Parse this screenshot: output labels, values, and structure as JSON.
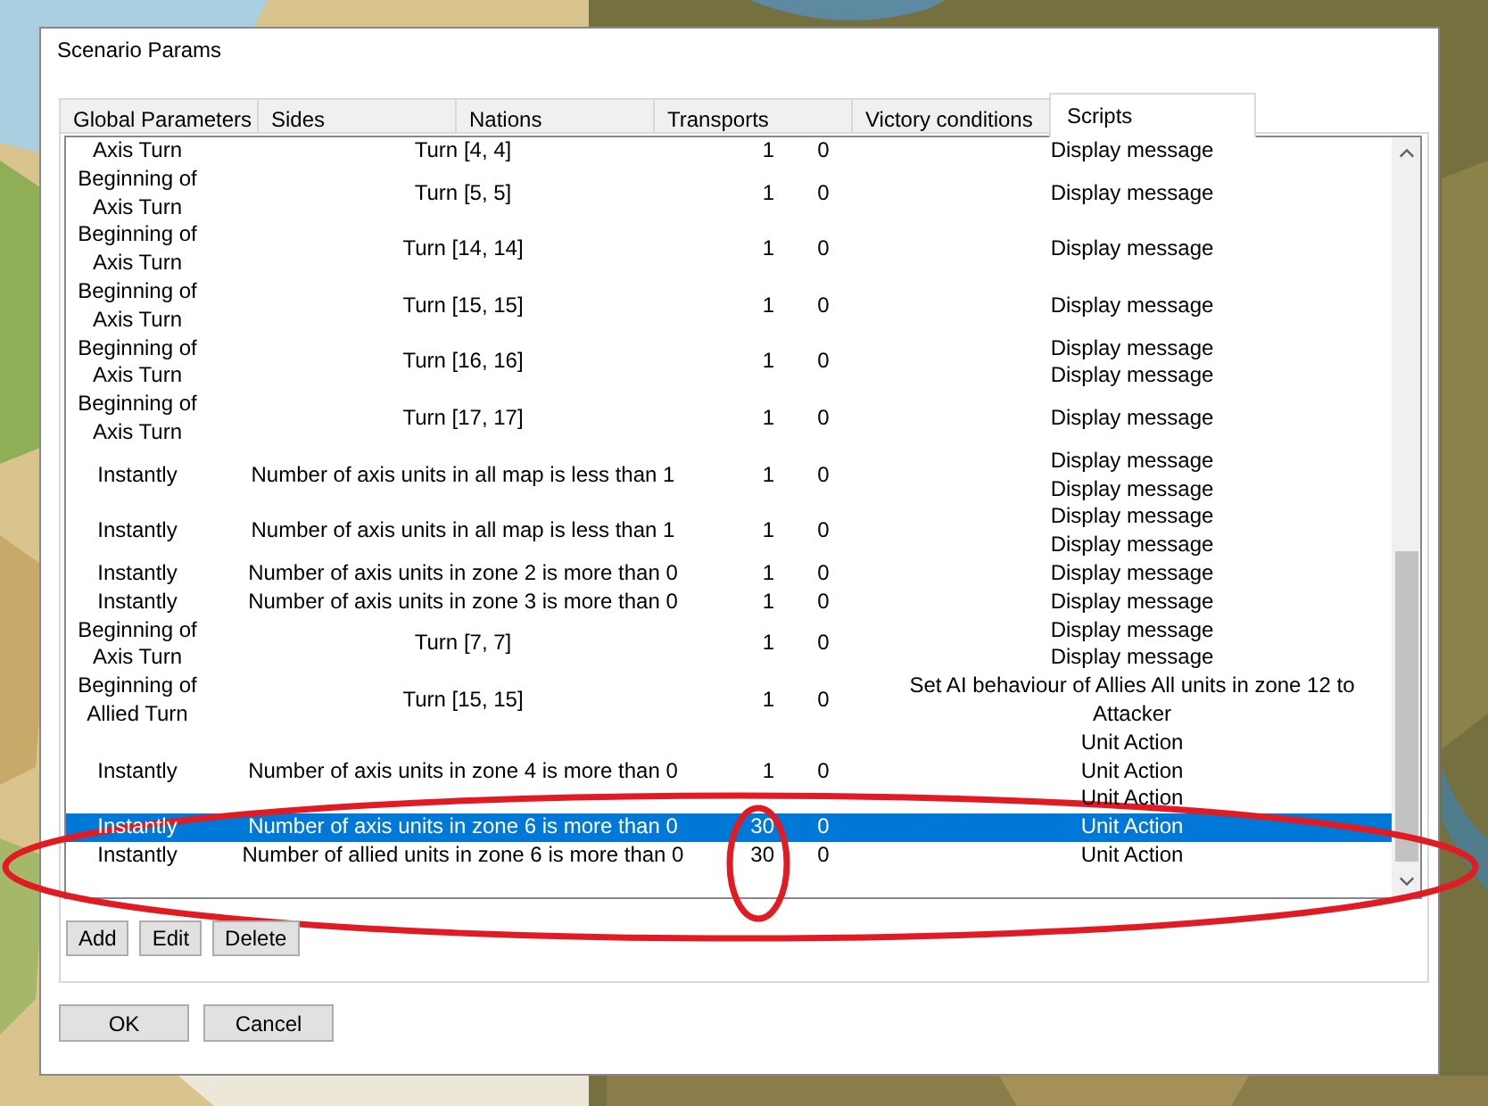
{
  "window": {
    "title": "Scenario Params"
  },
  "tabs": [
    {
      "label": "Global Parameters",
      "selected": false
    },
    {
      "label": "Sides",
      "selected": false
    },
    {
      "label": "Nations",
      "selected": false
    },
    {
      "label": "Transports",
      "selected": false
    },
    {
      "label": "Victory conditions",
      "selected": false
    },
    {
      "label": "Scripts",
      "selected": true
    }
  ],
  "table": {
    "rows": [
      {
        "column_1": "Axis Turn",
        "column_2": "Turn [4, 4]",
        "column_3": "1",
        "column_4": "0",
        "column_5": [
          "Display message"
        ],
        "selected": false
      },
      {
        "column_1": "Beginning of Axis Turn",
        "column_2": "Turn [5, 5]",
        "column_3": "1",
        "column_4": "0",
        "column_5": [
          "Display message"
        ],
        "selected": false
      },
      {
        "column_1": "Beginning of Axis Turn",
        "column_2": "Turn [14, 14]",
        "column_3": "1",
        "column_4": "0",
        "column_5": [
          "Display message"
        ],
        "selected": false
      },
      {
        "column_1": "Beginning of Axis Turn",
        "column_2": "Turn [15, 15]",
        "column_3": "1",
        "column_4": "0",
        "column_5": [
          "Display message"
        ],
        "selected": false
      },
      {
        "column_1": "Beginning of Axis Turn",
        "column_2": "Turn [16, 16]",
        "column_3": "1",
        "column_4": "0",
        "column_5": [
          "Display message",
          "Display message"
        ],
        "selected": false
      },
      {
        "column_1": "Beginning of Axis Turn",
        "column_2": "Turn [17, 17]",
        "column_3": "1",
        "column_4": "0",
        "column_5": [
          "Display message"
        ],
        "selected": false
      },
      {
        "column_1": "Instantly",
        "column_2": "Number of axis units in all map is less than 1",
        "column_3": "1",
        "column_4": "0",
        "column_5": [
          "Display message",
          "Display message"
        ],
        "selected": false
      },
      {
        "column_1": "Instantly",
        "column_2": "Number of axis units in all map is less than 1",
        "column_3": "1",
        "column_4": "0",
        "column_5": [
          "Display message",
          "Display message"
        ],
        "selected": false
      },
      {
        "column_1": "Instantly",
        "column_2": "Number of axis units in zone 2 is more than 0",
        "column_3": "1",
        "column_4": "0",
        "column_5": [
          "Display message"
        ],
        "selected": false
      },
      {
        "column_1": "Instantly",
        "column_2": "Number of axis units in zone 3 is more than 0",
        "column_3": "1",
        "column_4": "0",
        "column_5": [
          "Display message"
        ],
        "selected": false
      },
      {
        "column_1": "Beginning of Axis Turn",
        "column_2": "Turn [7, 7]",
        "column_3": "1",
        "column_4": "0",
        "column_5": [
          "Display message",
          "Display message"
        ],
        "selected": false
      },
      {
        "column_1": "Beginning of Allied Turn",
        "column_2": "Turn [15, 15]",
        "column_3": "1",
        "column_4": "0",
        "column_5": [
          "Set AI behaviour of Allies All units in zone 12 to Attacker"
        ],
        "selected": false
      },
      {
        "column_1": "Instantly",
        "column_2": "Number of axis units in zone 4 is more than 0",
        "column_3": "1",
        "column_4": "0",
        "column_5": [
          "Unit Action",
          "Unit Action",
          "Unit Action"
        ],
        "selected": false
      },
      {
        "column_1": "Instantly",
        "column_2": "Number of axis units in zone 6 is more than 0",
        "column_3": "30",
        "column_4": "0",
        "column_5": [
          "Unit Action"
        ],
        "selected": true
      },
      {
        "column_1": "Instantly",
        "column_2": "Number of allied units in zone 6 is more than 0",
        "column_3": "30",
        "column_4": "0",
        "column_5": [
          "Unit Action"
        ],
        "selected": false
      }
    ]
  },
  "list_buttons": [
    "Add",
    "Edit",
    "Delete"
  ],
  "dialog_buttons": [
    "OK",
    "Cancel"
  ]
}
